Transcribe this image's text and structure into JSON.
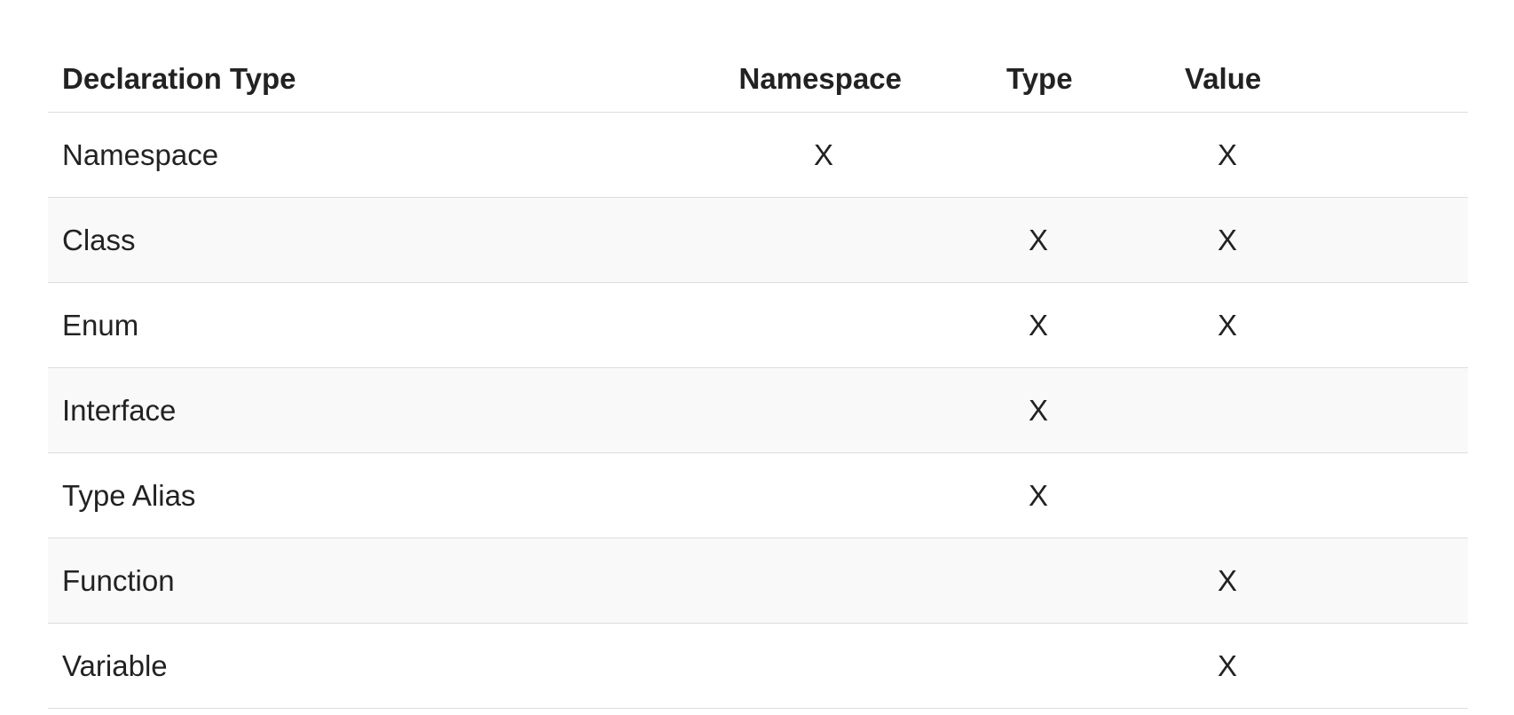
{
  "table": {
    "headers": {
      "declaration_type": "Declaration Type",
      "namespace": "Namespace",
      "type": "Type",
      "value": "Value"
    },
    "rows": [
      {
        "declaration_type": "Namespace",
        "namespace": "X",
        "type": "",
        "value": "X"
      },
      {
        "declaration_type": "Class",
        "namespace": "",
        "type": "X",
        "value": "X"
      },
      {
        "declaration_type": "Enum",
        "namespace": "",
        "type": "X",
        "value": "X"
      },
      {
        "declaration_type": "Interface",
        "namespace": "",
        "type": "X",
        "value": ""
      },
      {
        "declaration_type": "Type Alias",
        "namespace": "",
        "type": "X",
        "value": ""
      },
      {
        "declaration_type": "Function",
        "namespace": "",
        "type": "",
        "value": "X"
      },
      {
        "declaration_type": "Variable",
        "namespace": "",
        "type": "",
        "value": "X"
      }
    ]
  },
  "colors": {
    "text": "#222222",
    "row_stripe": "#f9f9f9",
    "border": "#dddddd",
    "background": "#ffffff"
  }
}
